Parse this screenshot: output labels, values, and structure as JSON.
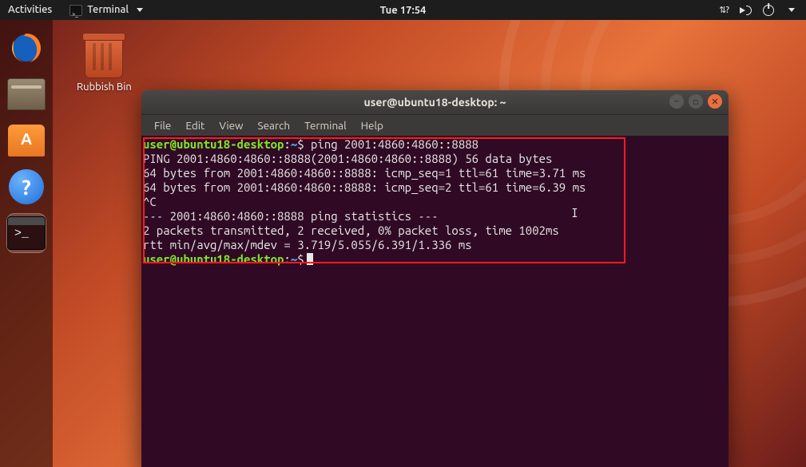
{
  "topbar": {
    "activities": "Activities",
    "app_indicator": "Terminal",
    "clock": "Tue 17:54"
  },
  "desktop": {
    "rubbish_label": "Rubbish Bin"
  },
  "window": {
    "title": "user@ubuntu18-desktop: ~",
    "menus": [
      "File",
      "Edit",
      "View",
      "Search",
      "Terminal",
      "Help"
    ]
  },
  "terminal": {
    "prompt_user": "user@ubuntu18-desktop",
    "prompt_sep": ":",
    "prompt_path": "~",
    "prompt_symbol": "$",
    "command": "ping 2001:4860:4860::8888",
    "lines": [
      "PING 2001:4860:4860::8888(2001:4860:4860::8888) 56 data bytes",
      "64 bytes from 2001:4860:4860::8888: icmp_seq=1 ttl=61 time=3.71 ms",
      "64 bytes from 2001:4860:4860::8888: icmp_seq=2 ttl=61 time=6.39 ms",
      "^C",
      "--- 2001:4860:4860::8888 ping statistics ---",
      "2 packets transmitted, 2 received, 0% packet loss, time 1002ms",
      "rtt min/avg/max/mdev = 3.719/5.055/6.391/1.336 ms"
    ]
  }
}
